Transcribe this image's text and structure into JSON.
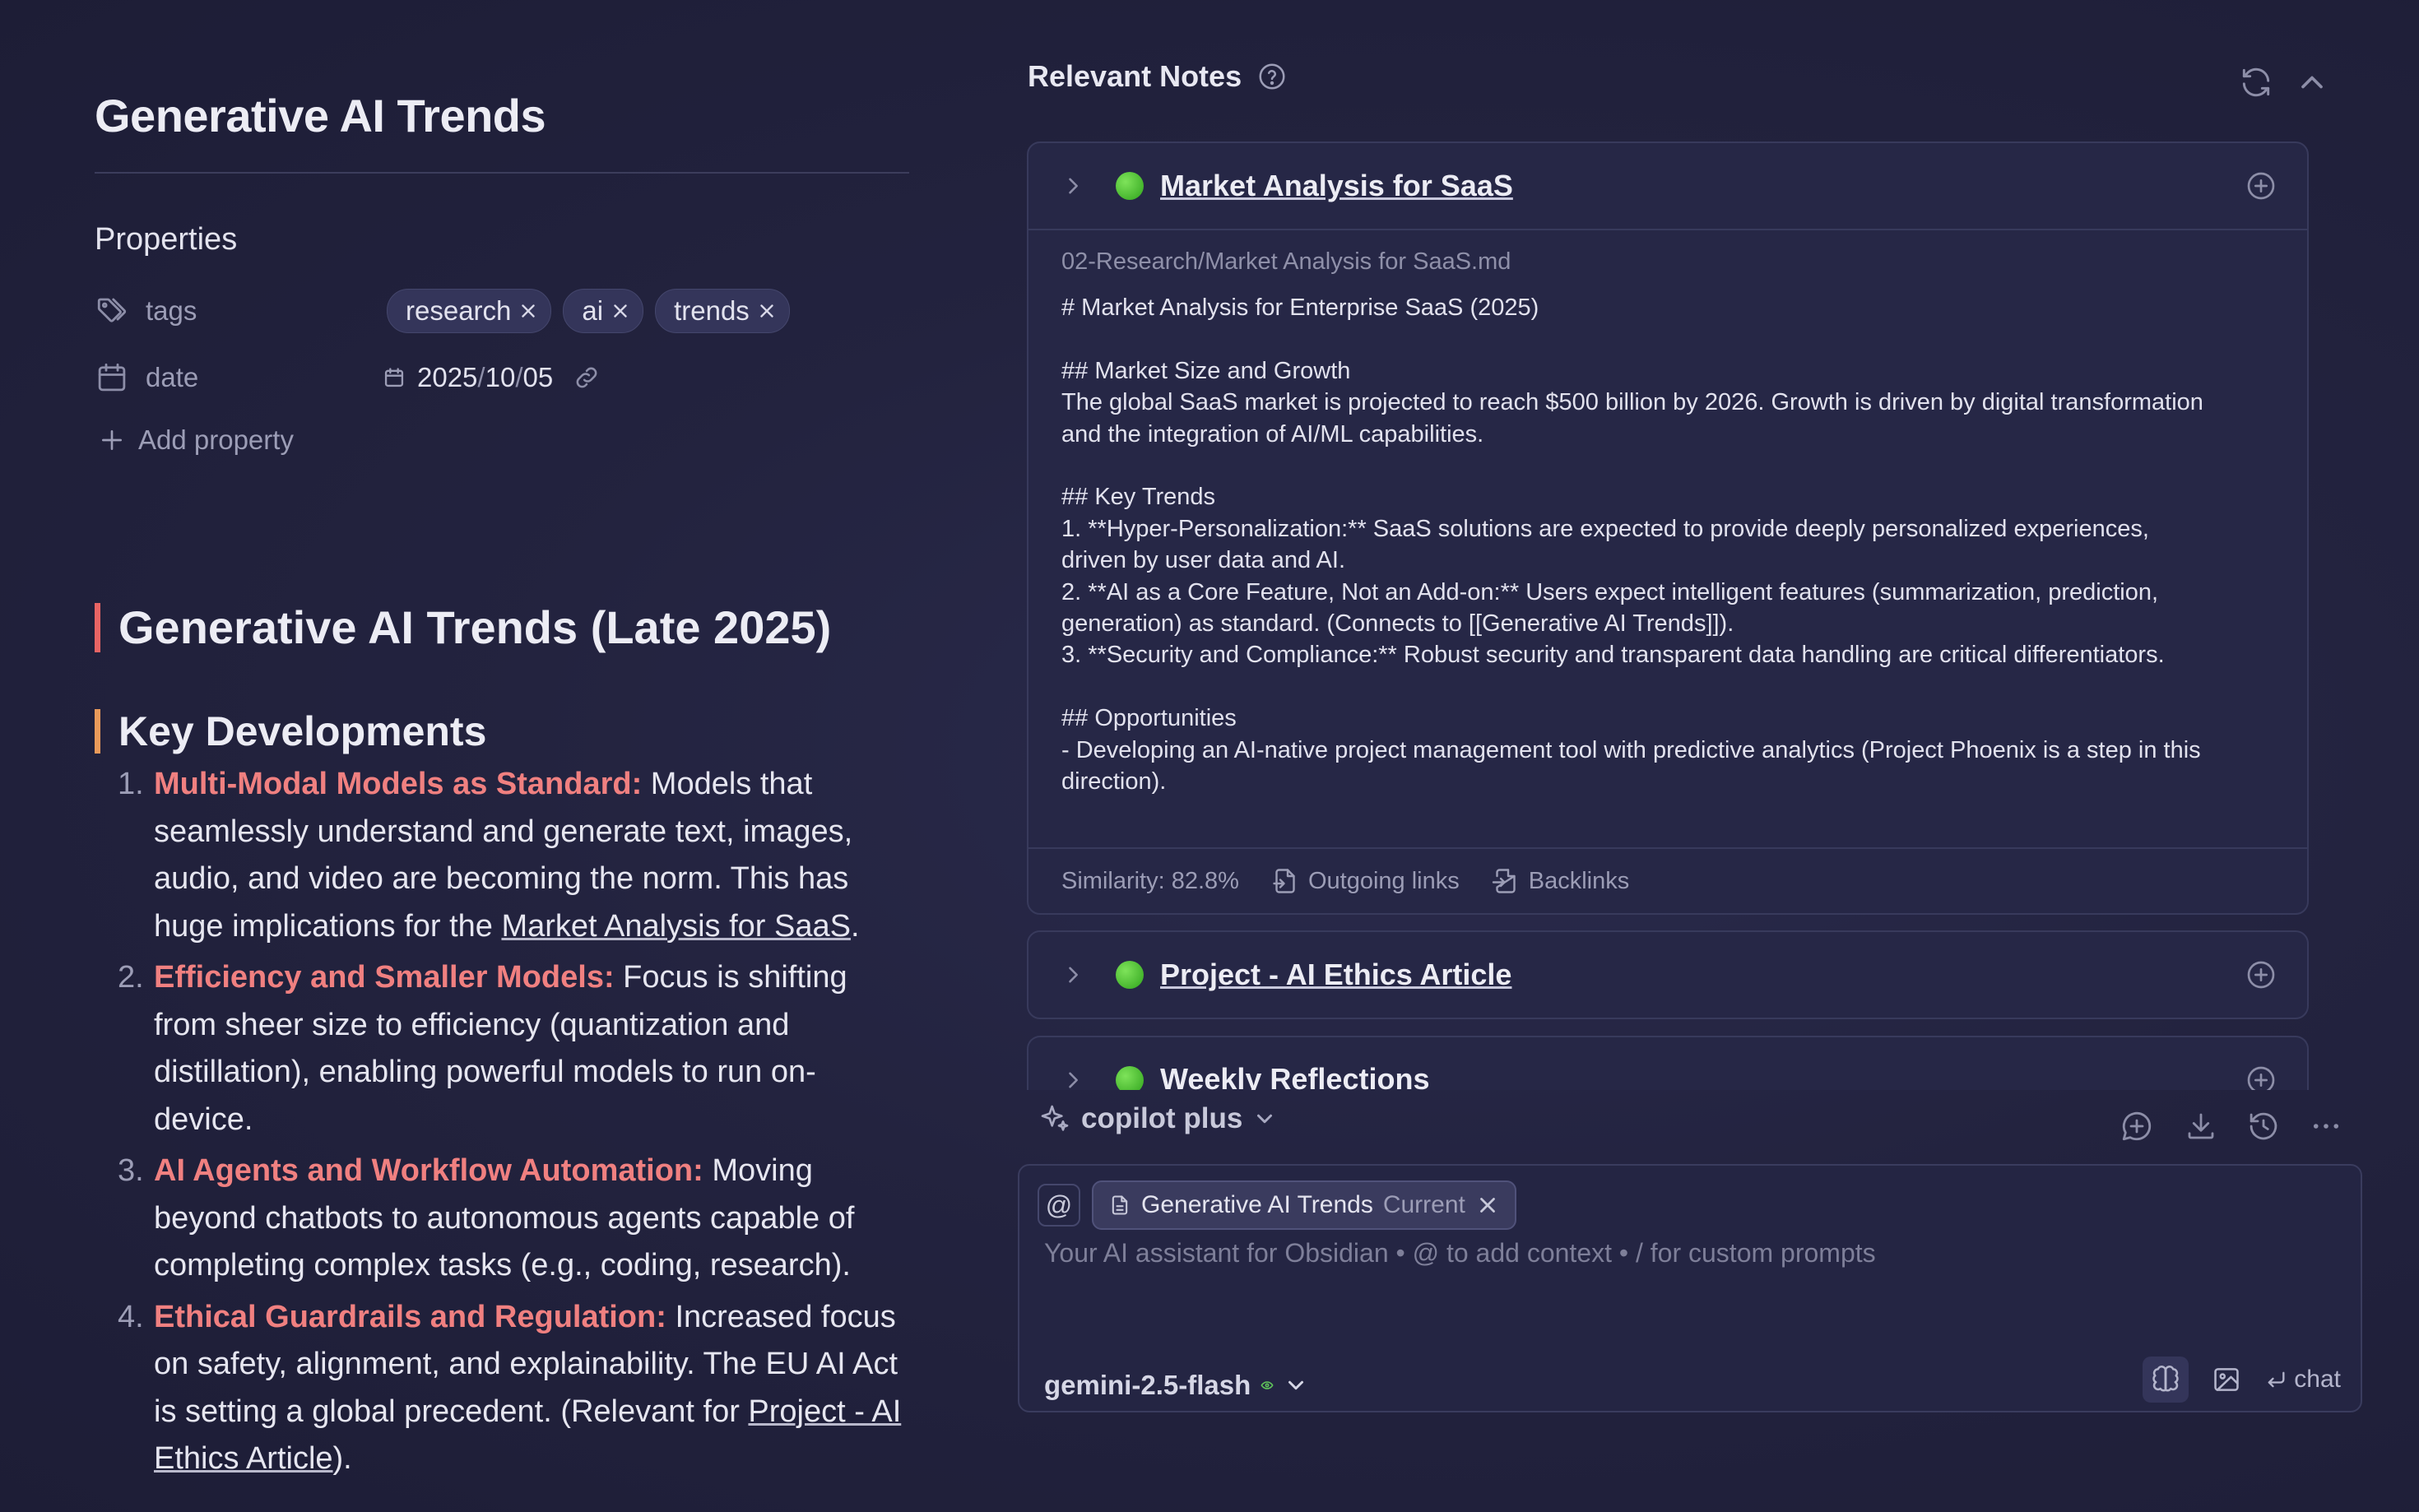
{
  "note": {
    "title": "Generative AI Trends",
    "properties_heading": "Properties",
    "tags_label": "tags",
    "tags": [
      "research",
      "ai",
      "trends"
    ],
    "date_label": "date",
    "date": {
      "year": "2025",
      "month": "10",
      "day": "05",
      "sep": "/"
    },
    "add_property": "Add property",
    "h1": "Generative AI Trends (Late 2025)",
    "h2": "Key Developments",
    "items": [
      {
        "num": "1.",
        "head": "Multi-Modal Models as Standard:",
        "text": " Models that seamlessly understand and generate text, images, audio, and video are becoming the norm. This has huge implications for the ",
        "link": "Market Analysis for SaaS",
        "tail": "."
      },
      {
        "num": "2.",
        "head": "Efficiency and Smaller Models:",
        "text": " Focus is shifting from sheer size to efficiency (quantization and distillation), enabling powerful models to run on-device.",
        "link": "",
        "tail": ""
      },
      {
        "num": "3.",
        "head": "AI Agents and Workflow Automation:",
        "text": " Moving beyond chatbots to autonomous agents capable of completing complex tasks (e.g., coding, research).",
        "link": "",
        "tail": ""
      },
      {
        "num": "4.",
        "head": "Ethical Guardrails and Regulation:",
        "text": " Increased focus on safety, alignment, and explainability. The EU AI Act is setting a global precedent. (Relevant for ",
        "link": "Project - AI Ethics Article",
        "tail": ")."
      }
    ]
  },
  "relevant_notes": {
    "header": "Relevant Notes",
    "cards": [
      {
        "title": "Market Analysis for SaaS",
        "path": "02-Research/Market Analysis for SaaS.md",
        "content_lines": [
          "# Market Analysis for Enterprise SaaS (2025)",
          "",
          "## Market Size and Growth",
          "The global SaaS market is projected to reach $500 billion by 2026. Growth is driven by digital transformation",
          "and the integration of AI/ML capabilities.",
          "",
          "## Key Trends",
          "1.  **Hyper-Personalization:** SaaS solutions are expected to provide deeply personalized experiences,",
          "driven by user data and AI.",
          "2.  **AI as a Core Feature, Not an Add-on:** Users expect intelligent features (summarization, prediction,",
          "generation) as standard. (Connects to [[Generative AI Trends]]).",
          "3.  **Security and Compliance:** Robust security and transparent data handling are critical differentiators.",
          "",
          "## Opportunities",
          "- Developing an AI-native project management tool with predictive analytics (Project Phoenix is a step in this",
          "direction)."
        ],
        "similarity": "Similarity: 82.8%",
        "outgoing": "Outgoing links",
        "backlinks": "Backlinks"
      },
      {
        "title": "Project - AI Ethics Article"
      },
      {
        "title": "Weekly Reflections"
      }
    ]
  },
  "copilot": {
    "mode": "copilot plus",
    "context_chip": "Generative AI Trends",
    "context_current": "Current",
    "at_symbol": "@",
    "placeholder": "Your AI assistant for Obsidian • @ to add context • / for custom prompts",
    "model": "gemini-2.5-flash",
    "send_label": "chat"
  },
  "colors": {
    "accent_h1": "#e86464",
    "accent_h2": "#e99a5a",
    "list_head": "#f08080",
    "status_dot": "#3cb526"
  }
}
